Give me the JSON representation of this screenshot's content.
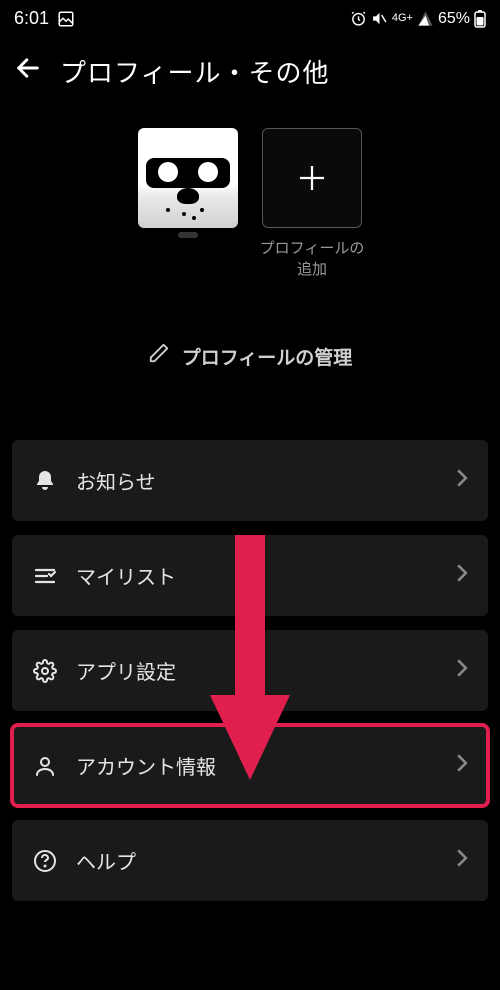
{
  "status": {
    "time": "6:01",
    "battery": "65%",
    "network": "4G+"
  },
  "header": {
    "title": "プロフィール・その他"
  },
  "profiles": {
    "addLabel": "プロフィールの追加"
  },
  "manageProfiles": {
    "label": "プロフィールの管理"
  },
  "menu": {
    "items": [
      {
        "label": "お知らせ"
      },
      {
        "label": "マイリスト"
      },
      {
        "label": "アプリ設定"
      },
      {
        "label": "アカウント情報"
      },
      {
        "label": "ヘルプ"
      }
    ]
  },
  "annotation": {
    "arrowColor": "#e01f4f"
  }
}
